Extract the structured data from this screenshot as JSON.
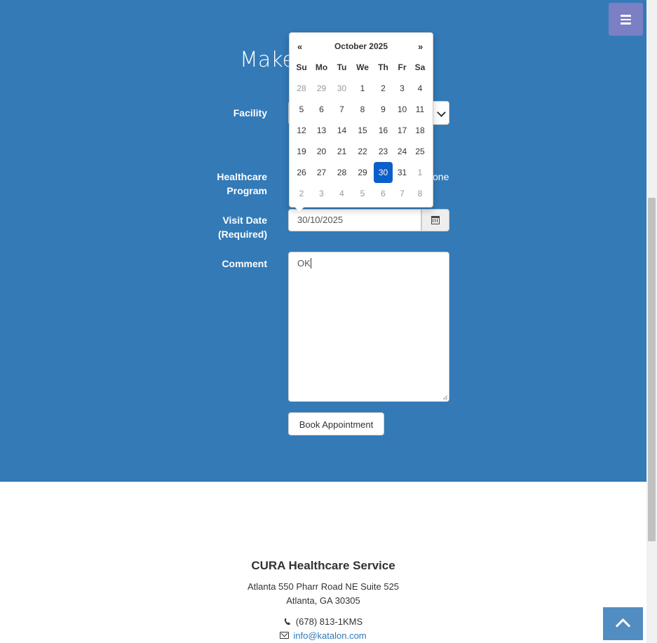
{
  "header": {
    "title": "Make"
  },
  "form": {
    "facility_label": "Facility",
    "program_label_1": "Healthcare",
    "program_label_2": "Program",
    "program_option_visible": "one",
    "visit_date_label_1": "Visit Date",
    "visit_date_label_2": "(Required)",
    "visit_date_value": "30/10/2025",
    "comment_label": "Comment",
    "comment_value": "OK",
    "book_button": "Book Appointment"
  },
  "datepicker": {
    "prev": "«",
    "next": "»",
    "title": "October 2025",
    "weekdays": [
      "Su",
      "Mo",
      "Tu",
      "We",
      "Th",
      "Fr",
      "Sa"
    ],
    "weeks": [
      [
        "28",
        "29",
        "30",
        "1",
        "2",
        "3",
        "4"
      ],
      [
        "5",
        "6",
        "7",
        "8",
        "9",
        "10",
        "11"
      ],
      [
        "12",
        "13",
        "14",
        "15",
        "16",
        "17",
        "18"
      ],
      [
        "19",
        "20",
        "21",
        "22",
        "23",
        "24",
        "25"
      ],
      [
        "26",
        "27",
        "28",
        "29",
        "30",
        "31",
        "1"
      ],
      [
        "2",
        "3",
        "4",
        "5",
        "6",
        "7",
        "8"
      ]
    ],
    "selected_day": "30",
    "active_color": "#0b5fc9"
  },
  "footer": {
    "title": "CURA Healthcare Service",
    "address_1": "Atlanta 550 Pharr Road NE Suite 525",
    "address_2": "Atlanta, GA 30305",
    "phone": "(678) 813-1KMS",
    "email": "info@katalon.com"
  },
  "icons": {
    "menu": "menu-icon",
    "calendar": "calendar-icon",
    "phone": "phone-icon",
    "mail": "envelope-icon",
    "to_top": "chevron-up-icon"
  },
  "colors": {
    "primary": "#337ab7",
    "menu_toggle": "#7b7fc4"
  }
}
